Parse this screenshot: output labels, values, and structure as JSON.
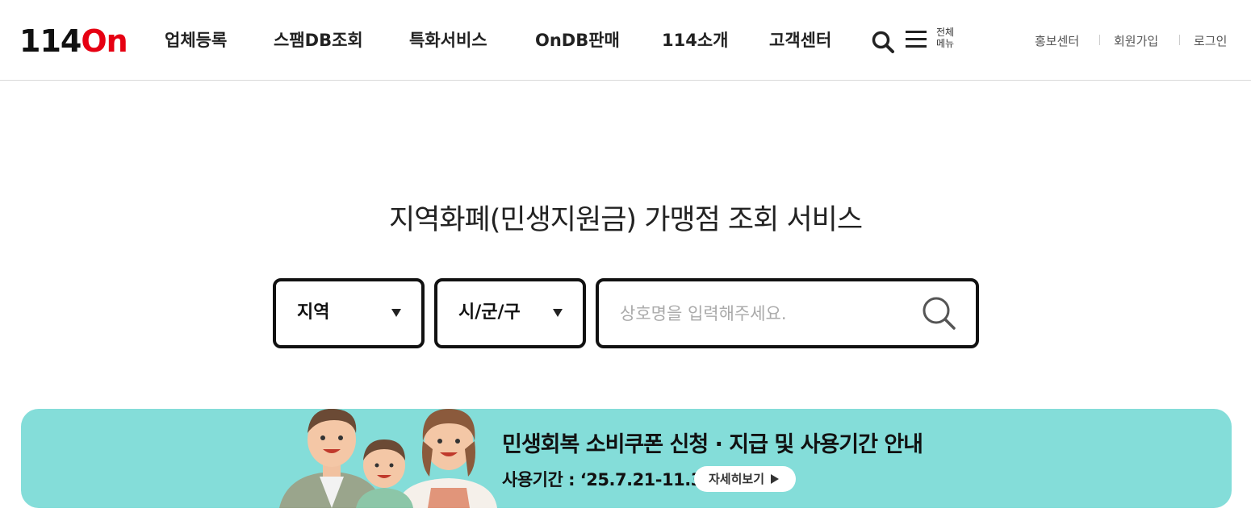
{
  "header": {
    "logo": {
      "text_dark": "114",
      "text_accent": "On"
    },
    "nav": [
      {
        "label": "업체등록"
      },
      {
        "label": "스팸DB조회"
      },
      {
        "label": "특화서비스"
      },
      {
        "label": "OnDB판매"
      },
      {
        "label": "114소개"
      },
      {
        "label": "고객센터"
      }
    ],
    "search_icon": "search-icon",
    "all_menu": {
      "line1": "전체",
      "line2": "메뉴",
      "icon": "hamburger-icon"
    },
    "util_links": [
      {
        "label": "홍보센터"
      },
      {
        "label": "회원가입"
      },
      {
        "label": "로그인"
      }
    ]
  },
  "main": {
    "title": "지역화폐(민생지원금) 가맹점 조회 서비스",
    "region_select": {
      "value": "지역",
      "icon": "caret-down-icon"
    },
    "district_select": {
      "value": "시/군/구",
      "icon": "caret-down-icon"
    },
    "search": {
      "placeholder": "상호명을 입력해주세요.",
      "value": "",
      "icon": "search-icon"
    }
  },
  "banner": {
    "title": "민생회복 소비쿠폰 신청 · 지급 및 사용기간 안내",
    "period": "사용기간 : ‘25.7.21-11.30",
    "button_label": "자세히보기",
    "illustration": "family-illustration"
  },
  "colors": {
    "accent": "#e60012",
    "banner_bg": "#84ddd9",
    "border": "#111111"
  }
}
